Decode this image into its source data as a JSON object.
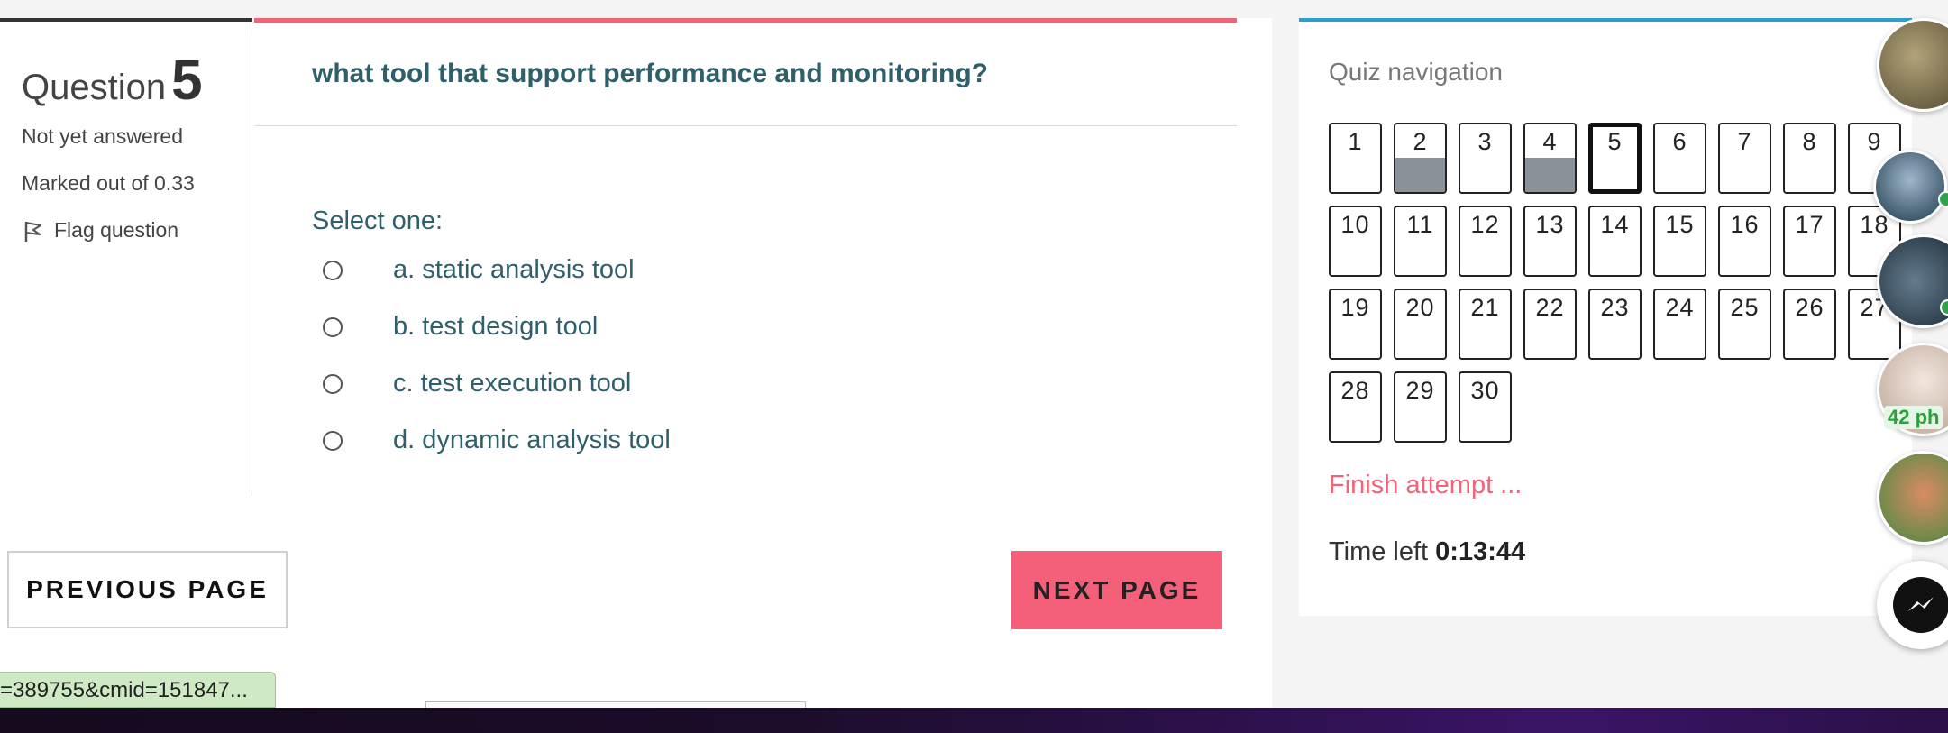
{
  "question_info": {
    "label": "Question",
    "number": "5",
    "state": "Not yet answered",
    "mark": "Marked out of 0.33",
    "flag_label": "Flag question"
  },
  "question": {
    "text": "what tool that support performance and monitoring?",
    "prompt": "Select one:",
    "options": [
      {
        "label": "a. static analysis tool"
      },
      {
        "label": "b. test design tool"
      },
      {
        "label": "c. test execution tool"
      },
      {
        "label": "d. dynamic analysis tool"
      }
    ]
  },
  "buttons": {
    "previous": "PREVIOUS PAGE",
    "next": "NEXT PAGE"
  },
  "status_url": "=389755&cmid=151847...",
  "quiz_nav": {
    "title": "Quiz navigation",
    "questions": [
      "1",
      "2",
      "3",
      "4",
      "5",
      "6",
      "7",
      "8",
      "9",
      "10",
      "11",
      "12",
      "13",
      "14",
      "15",
      "16",
      "17",
      "18",
      "19",
      "20",
      "21",
      "22",
      "23",
      "24",
      "25",
      "26",
      "27",
      "28",
      "29",
      "30"
    ],
    "answered": [
      "2",
      "4"
    ],
    "current": "5",
    "finish_label": "Finish attempt ...",
    "time_label": "Time left",
    "time_value": "0:13:44"
  },
  "chat_heads": {
    "minutes_badge": "42 ph"
  },
  "colors": {
    "accent_pink": "#ef6478",
    "accent_blue": "#2b9fce",
    "question_teal": "#2e5f6b",
    "answered_fill": "#8a9197"
  },
  "icons": [
    "flag-icon",
    "radio-icon",
    "messenger-icon"
  ]
}
